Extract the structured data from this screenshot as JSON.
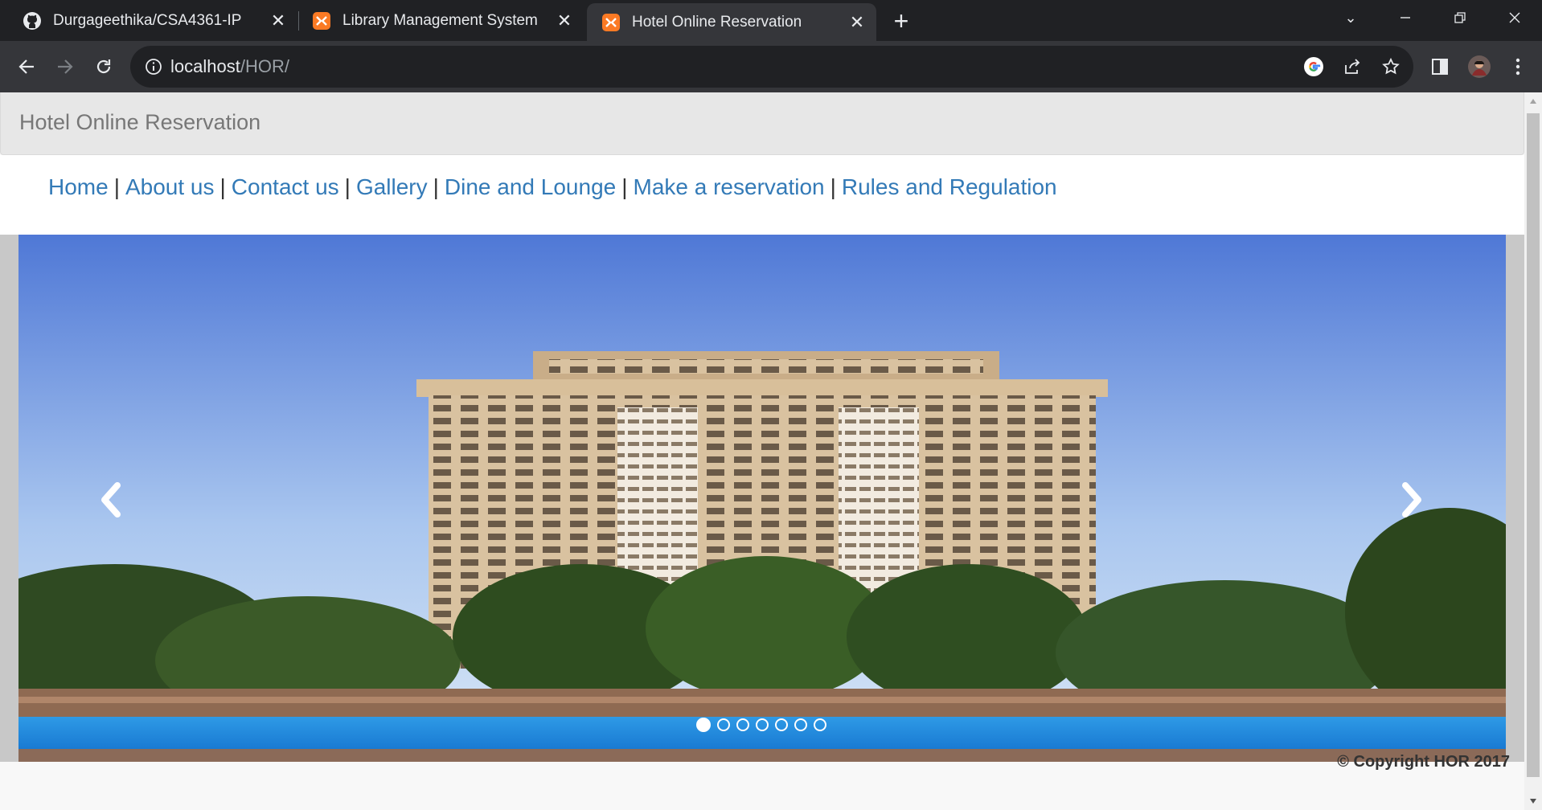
{
  "browser": {
    "tabs": [
      {
        "title": "Durgageethika/CSA4361-IP",
        "favicon": "github-icon",
        "active": false
      },
      {
        "title": "Library Management System",
        "favicon": "xampp-icon",
        "active": false
      },
      {
        "title": "Hotel Online Reservation",
        "favicon": "xampp-icon",
        "active": true
      }
    ],
    "address": {
      "host": "localhost",
      "path": "/HOR/"
    },
    "icons": [
      "back-icon",
      "forward-icon",
      "reload-icon",
      "info-icon",
      "google-icon",
      "share-icon",
      "star-icon",
      "side-panel-icon",
      "profile-avatar",
      "menu-icon"
    ]
  },
  "page": {
    "brand": "Hotel Online Reservation",
    "menu": [
      {
        "label": "Home"
      },
      {
        "label": "About us"
      },
      {
        "label": "Contact us"
      },
      {
        "label": "Gallery"
      },
      {
        "label": "Dine and Lounge"
      },
      {
        "label": "Make a reservation"
      },
      {
        "label": "Rules and Regulation"
      }
    ],
    "menu_separator": "|",
    "carousel": {
      "slides_count": 7,
      "active_index": 0,
      "image": "hotel building with pool"
    },
    "footer": "© Copyright HOR 2017"
  },
  "colors": {
    "link": "#337ab7",
    "navbar": "#e7e7e7",
    "brand_text": "#777777",
    "chrome_dark": "#202124",
    "chrome_toolbar": "#35363a"
  }
}
